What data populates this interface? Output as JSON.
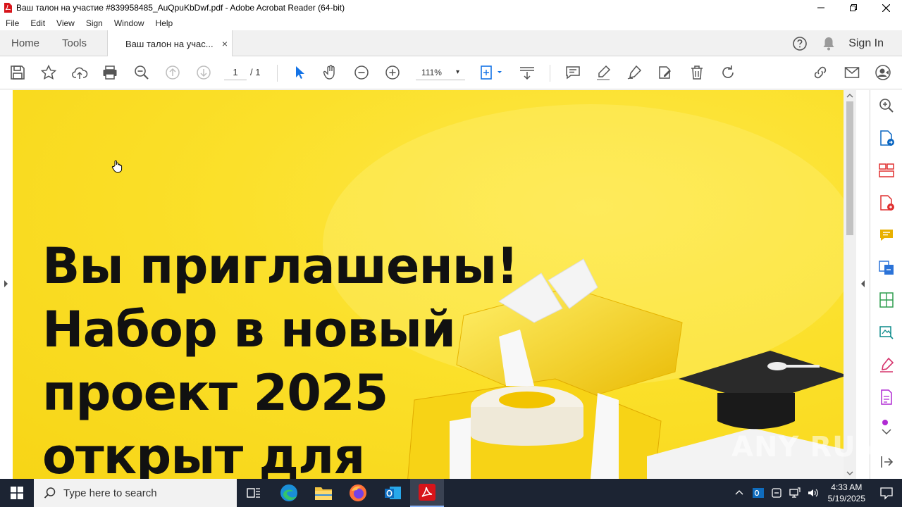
{
  "window": {
    "title": "Ваш талон на участие #839958485_AuQpuKbDwf.pdf - Adobe Acrobat Reader (64-bit)"
  },
  "menu": [
    "File",
    "Edit",
    "View",
    "Sign",
    "Window",
    "Help"
  ],
  "tabs": {
    "home": "Home",
    "tools": "Tools",
    "document": "Ваш талон на учас...",
    "close": "×",
    "sign_in": "Sign In"
  },
  "toolbar": {
    "current_page": "1",
    "page_total": "/ 1",
    "zoom": "111%",
    "zoom_caret": "▾"
  },
  "document": {
    "headline_lines": [
      "Вы приглашены!",
      "Набор в новый",
      "проект 2025",
      "открыт для"
    ],
    "accent_color": "#fbe02a"
  },
  "watermark": "ANY RUN",
  "taskbar": {
    "search_placeholder": "Type here to search",
    "time": "4:33 AM",
    "date": "5/19/2025"
  },
  "colors": {
    "acrobat_red": "#d7141a",
    "taskbar_bg": "#1c2433",
    "right_panel_icons": [
      "#0a66c2",
      "#e03131",
      "#e8b000",
      "#2b73d8",
      "#2e9d4e",
      "#0b8a8a",
      "#d6336c"
    ]
  }
}
